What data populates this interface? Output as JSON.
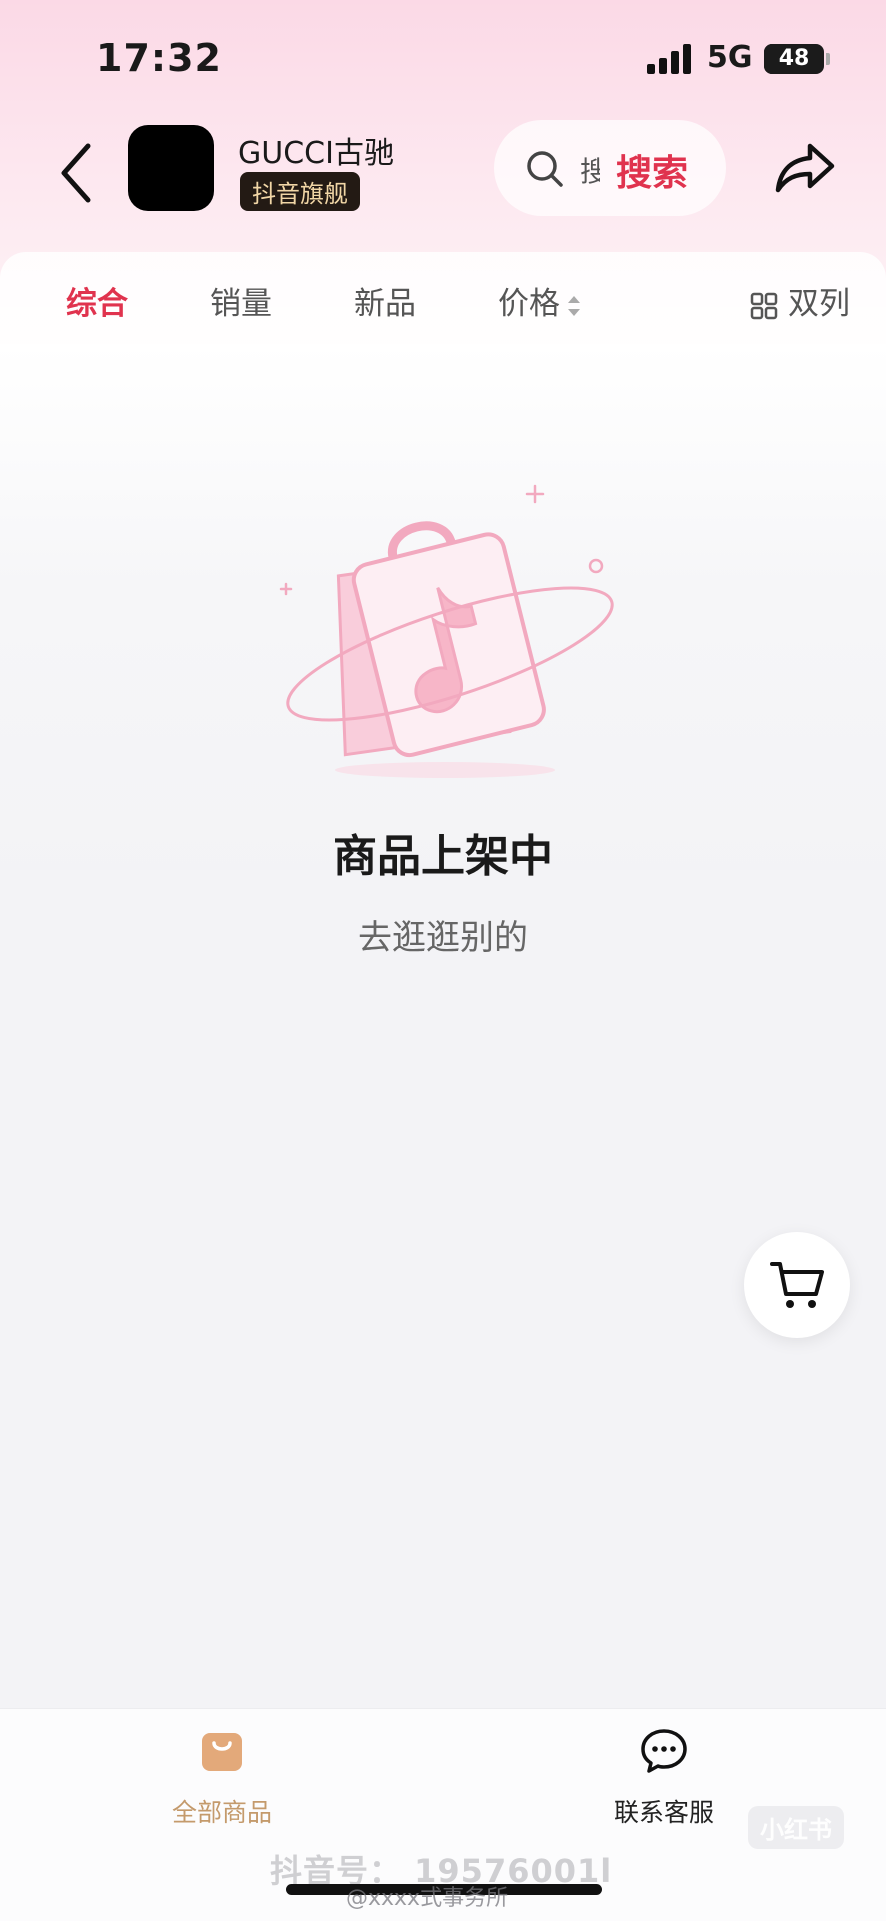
{
  "status_bar": {
    "time": "17:32",
    "network": "5G",
    "battery": "48",
    "battery_level_percent": 48
  },
  "header": {
    "shop_name": "GUCCI古驰",
    "shop_badge": "抖音旗舰",
    "search_placeholder": "搜",
    "search_label": "搜索",
    "icons": [
      "chevron-left-icon",
      "search-icon",
      "share-icon"
    ]
  },
  "sort_bar": {
    "tabs": [
      {
        "label": "综合",
        "active": true
      },
      {
        "label": "销量",
        "active": false
      },
      {
        "label": "新品",
        "active": false
      },
      {
        "label": "价格",
        "active": false
      }
    ],
    "layout_toggle": "双列"
  },
  "empty_state": {
    "title": "商品上架中",
    "subtitle": "去逛逛别的",
    "illustration_icon": "douyin-shopping-bag-icon"
  },
  "bottom_bar": {
    "all_products": "全部商品",
    "customer_service": "联系客服"
  },
  "watermarks": {
    "douyin_id": "抖音号：  19576001l",
    "xiaohongshu": "小红书",
    "weibo": "@xxxx式事务所"
  },
  "colors": {
    "accent": "#e0334e",
    "badge_text": "#f1d6a6",
    "tab_gold": "#c49a6c",
    "illustration_pink": "#f2a9bf"
  }
}
